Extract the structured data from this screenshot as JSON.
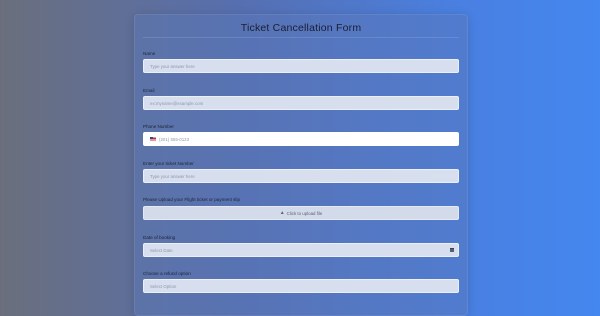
{
  "form": {
    "title": "Ticket Cancellation Form",
    "fields": [
      {
        "label": "Name",
        "placeholder": "Type your answer here"
      },
      {
        "label": "Email",
        "placeholder": "ex:myname@example.com"
      },
      {
        "label": "Phone Number",
        "placeholder": "(201) 555-0123",
        "flag": "us-flag-icon"
      },
      {
        "label": "Enter your ticket Number",
        "placeholder": "Type your answer here"
      },
      {
        "label": "Please Upload your Flight ticket or payment slip",
        "upload_label": "Click to upload file",
        "icon": "upload-icon"
      },
      {
        "label": "Date of booking",
        "placeholder": "Select Date",
        "icon": "calendar-icon"
      },
      {
        "label": "Choose a refund option",
        "placeholder": "Select Option"
      }
    ]
  }
}
